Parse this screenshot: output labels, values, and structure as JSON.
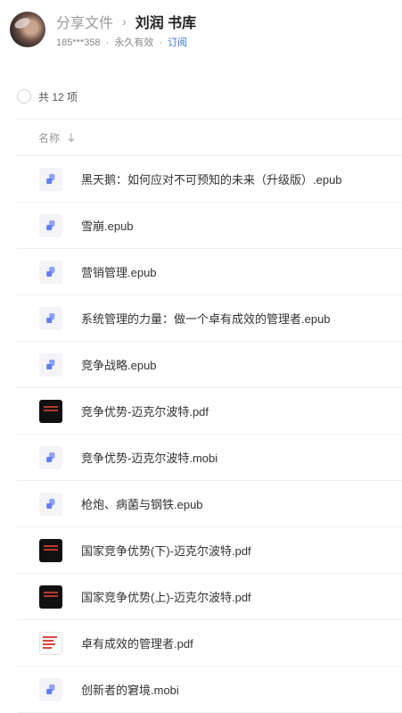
{
  "header": {
    "parent_label": "分享文件",
    "separator": "›",
    "title": "刘润 书库",
    "phone": "185***358",
    "dot": "·",
    "validity": "永久有效",
    "subscribe": "订阅"
  },
  "list": {
    "count_label": "共 12 项",
    "column_name": "名称",
    "files": [
      {
        "name": "黑天鹅：如何应对不可预知的未来（升级版）.epub",
        "thumb": "epub"
      },
      {
        "name": "雪崩.epub",
        "thumb": "epub"
      },
      {
        "name": "营销管理.epub",
        "thumb": "epub"
      },
      {
        "name": "系统管理的力量：做一个卓有成效的管理者.epub",
        "thumb": "epub"
      },
      {
        "name": "竞争战略.epub",
        "thumb": "epub"
      },
      {
        "name": "竞争优势-迈克尔波特.pdf",
        "thumb": "pdf-black"
      },
      {
        "name": "竞争优势-迈克尔波特.mobi",
        "thumb": "epub"
      },
      {
        "name": "枪炮、病菌与钢铁.epub",
        "thumb": "epub"
      },
      {
        "name": "国家竞争优势(下)-迈克尔波特.pdf",
        "thumb": "pdf-black"
      },
      {
        "name": "国家竞争优势(上)-迈克尔波特.pdf",
        "thumb": "pdf-black"
      },
      {
        "name": "卓有成效的管理者.pdf",
        "thumb": "pdf-white"
      },
      {
        "name": "创新者的窘境.mobi",
        "thumb": "epub"
      }
    ]
  },
  "colors": {
    "accent": "#3b73e6",
    "file_icon": "#8aa2ff",
    "file_icon_dark": "#5f7ef5"
  }
}
